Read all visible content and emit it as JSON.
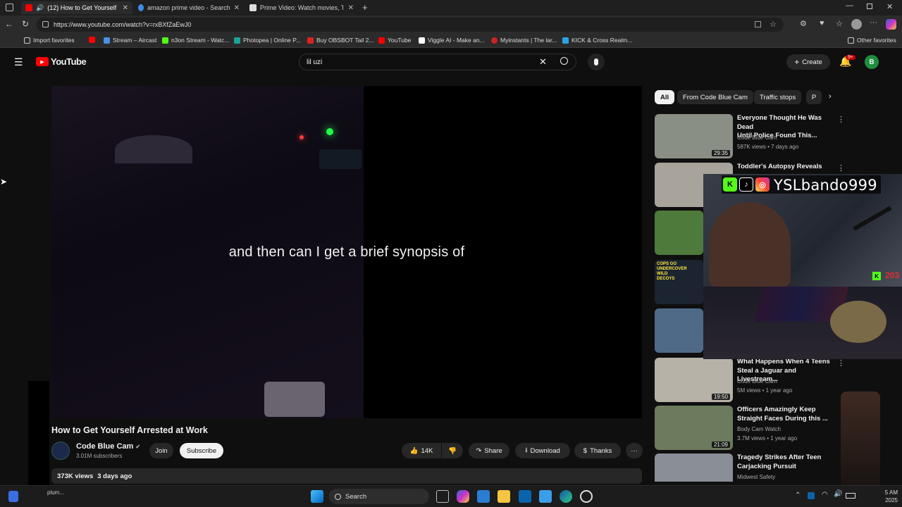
{
  "browser": {
    "tabs": [
      {
        "label": "(12) How to Get Yourself Arr",
        "favicon_color": "#ff0000",
        "active": true
      },
      {
        "label": "amazon prime video - Search",
        "favicon_color": "#3a8ee6",
        "active": false
      },
      {
        "label": "Prime Video: Watch movies, TV sh",
        "favicon_color": "#dddddd",
        "active": false
      }
    ],
    "url": "https://www.youtube.com/watch?v=rxBXfZaEwJ0",
    "bookmarks": [
      {
        "label": "Import favorites",
        "color": "#cccccc"
      },
      {
        "label": "",
        "color": "#ff0000"
      },
      {
        "label": "Stream – Aircast",
        "color": "#4a90e2"
      },
      {
        "label": "n3on Stream - Watc...",
        "color": "#53fc18"
      },
      {
        "label": "Photopea | Online P...",
        "color": "#18a497"
      },
      {
        "label": "Buy OBSBOT Tail 2...",
        "color": "#d22"
      },
      {
        "label": "YouTube",
        "color": "#ff0000"
      },
      {
        "label": "Viggle AI - Make an...",
        "color": "#ffffff"
      },
      {
        "label": "Myinstants | The lar...",
        "color": "#cc2222"
      },
      {
        "label": "KICK & Cross Realm...",
        "color": "#29a3e6"
      }
    ],
    "other_favorites": "Other favorites"
  },
  "youtube": {
    "logo_text": "YouTube",
    "search_value": "lil uzi",
    "create_label": "Create",
    "notif_count": "9+",
    "avatar_letter": "B"
  },
  "player": {
    "caption": "and then can I get a brief synopsis of",
    "title": "How to Get Yourself Arrested at Work",
    "channel": "Code Blue Cam",
    "subscribers": "3.01M subscribers",
    "join_label": "Join",
    "subscribe_label": "Subscribe",
    "likes": "14K",
    "share_label": "Share",
    "download_label": "Download",
    "thanks_label": "Thanks",
    "views": "373K views",
    "date": "3 days ago"
  },
  "chips": [
    "All",
    "From Code Blue Cam",
    "Traffic stops",
    "P"
  ],
  "related": [
    {
      "title_line1": "Everyone Thought He Was Dead",
      "title_line2": "Until Police Found This...",
      "channel": "Code Blue Cam",
      "meta": "587K views • 7 days ago",
      "duration": "29:35",
      "thumb_color": "#8a8f86"
    },
    {
      "title_line1": "Toddler's Autopsy Reveals",
      "title_line2": "",
      "channel": "",
      "meta": "",
      "duration": "",
      "thumb_color": "#a8a49c"
    },
    {
      "title_line1": "",
      "title_line2": "",
      "channel": "",
      "meta": "",
      "duration": "",
      "thumb_color": "#4e7a3c"
    },
    {
      "title_line1": "",
      "title_line2": "",
      "channel": "",
      "meta": "",
      "duration": "",
      "thumb_color": "#1b2430"
    },
    {
      "title_line1": "",
      "title_line2": "",
      "channel": "",
      "meta": "",
      "duration": "",
      "thumb_color": "#4f6a86"
    },
    {
      "title_line1": "What Happens When 4 Teens",
      "title_line2": "Steal a Jaguar and Livestream...",
      "channel": "Code Blue Cam",
      "meta": "5M views • 1 year ago",
      "duration": "19:50",
      "thumb_color": "#b7b2a8"
    },
    {
      "title_line1": "Officers Amazingly Keep",
      "title_line2": "Straight Faces During this ...",
      "channel": "Body Cam Watch",
      "meta": "3.7M views • 1 year ago",
      "duration": "21:09",
      "thumb_color": "#6c7a5e"
    },
    {
      "title_line1": "Tragedy Strikes After Teen",
      "title_line2": "Carjacking Pursuit",
      "channel": "Midwest Safety",
      "meta": "",
      "duration": "",
      "thumb_color": "#8a8e96"
    }
  ],
  "thumb_text": "COPS GO UNDERCOVER WILD DECOYS",
  "overlay": {
    "handle": "YSLbando999",
    "viewer_count": "203"
  },
  "taskbar": {
    "search_placeholder": "Search",
    "left_item": "plum...",
    "clock_line1": "5 AM",
    "clock_line2": "2025"
  }
}
